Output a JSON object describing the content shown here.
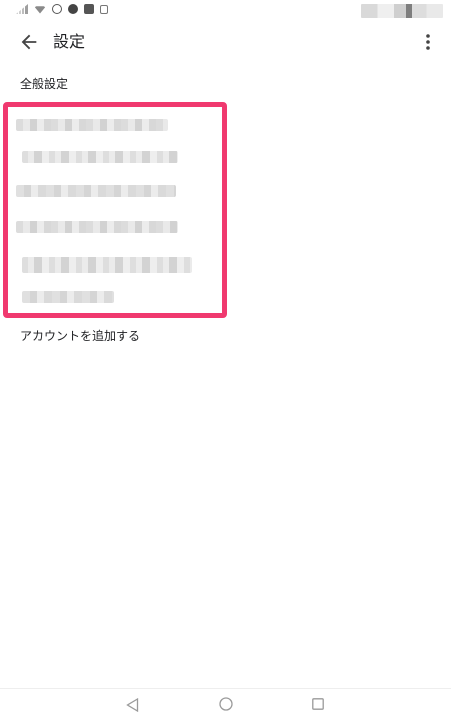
{
  "app_bar": {
    "title": "設定"
  },
  "section": {
    "header": "全般設定"
  },
  "accounts": {
    "add_account_label": "アカウントを追加する",
    "highlight_color": "#f0396f"
  },
  "icons": {
    "back": "arrow-left-icon",
    "more": "more-vert-icon",
    "nav_back": "triangle-back-icon",
    "nav_home": "circle-home-icon",
    "nav_recent": "square-recent-icon"
  }
}
